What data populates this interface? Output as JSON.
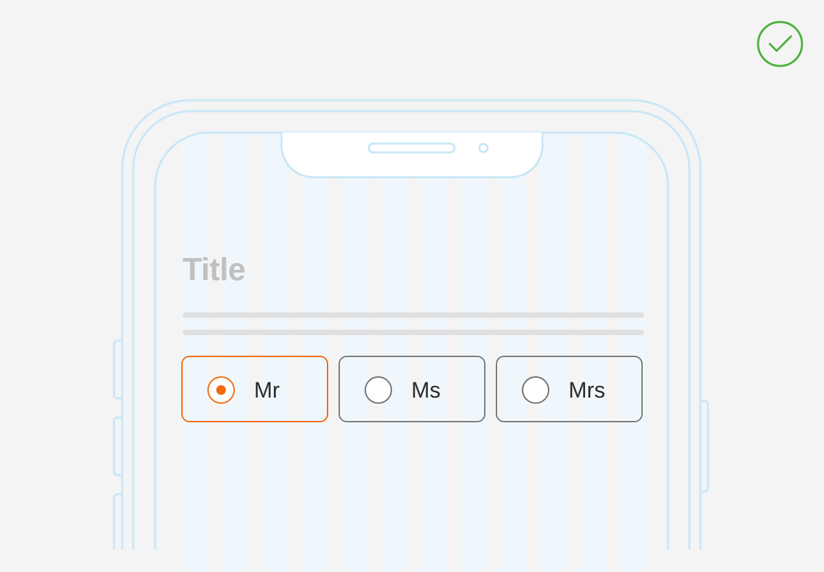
{
  "screen": {
    "title": "Title"
  },
  "radio_group": {
    "options": [
      {
        "label": "Mr",
        "selected": true
      },
      {
        "label": "Ms",
        "selected": false
      },
      {
        "label": "Mrs",
        "selected": false
      }
    ]
  },
  "status": {
    "icon": "checkmark-circle-icon"
  },
  "colors": {
    "accent": "#f06a0f",
    "success": "#4caf3d",
    "frame": "#c8e7f7"
  }
}
